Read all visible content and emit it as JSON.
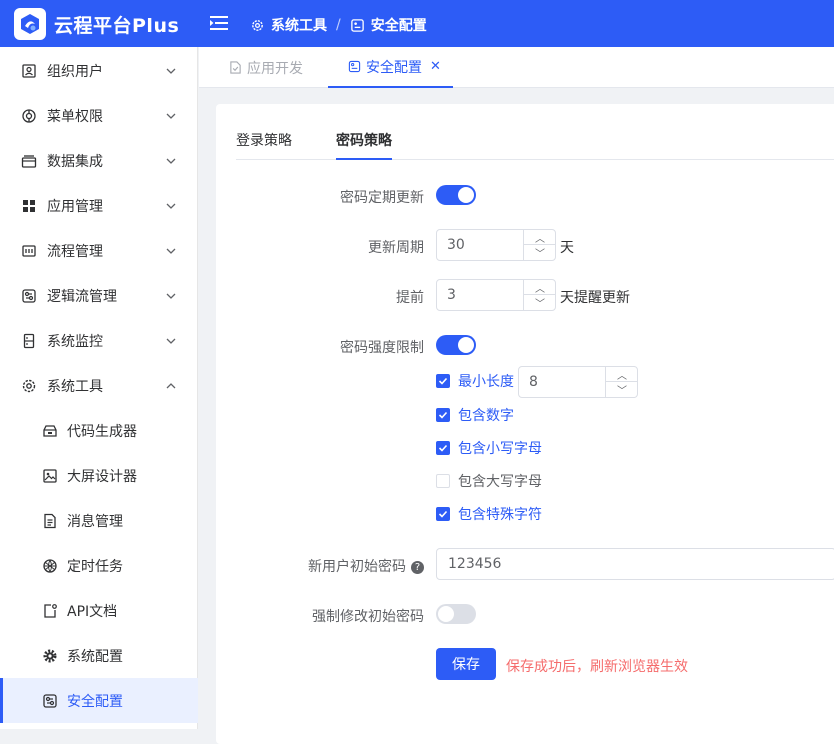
{
  "app": {
    "title": "云程平台Plus"
  },
  "breadcrumb": {
    "parent": "系统工具",
    "sep": "/",
    "current": "安全配置"
  },
  "sidebar": {
    "items": [
      {
        "label": "组织用户",
        "icon": "org-user-icon"
      },
      {
        "label": "菜单权限",
        "icon": "menu-perm-icon"
      },
      {
        "label": "数据集成",
        "icon": "data-integration-icon"
      },
      {
        "label": "应用管理",
        "icon": "app-grid-icon"
      },
      {
        "label": "流程管理",
        "icon": "flow-icon"
      },
      {
        "label": "逻辑流管理",
        "icon": "logic-flow-icon"
      },
      {
        "label": "系统监控",
        "icon": "monitor-icon"
      },
      {
        "label": "系统工具",
        "icon": "gear-icon"
      }
    ],
    "subitems": [
      {
        "label": "代码生成器",
        "icon": "code-gen-icon"
      },
      {
        "label": "大屏设计器",
        "icon": "image-icon"
      },
      {
        "label": "消息管理",
        "icon": "document-icon"
      },
      {
        "label": "定时任务",
        "icon": "timer-icon"
      },
      {
        "label": "API文档",
        "icon": "api-doc-icon"
      },
      {
        "label": "系统配置",
        "icon": "settings-icon"
      },
      {
        "label": "安全配置",
        "icon": "security-config-icon"
      }
    ]
  },
  "tabs": [
    {
      "label": "应用开发",
      "active": false
    },
    {
      "label": "安全配置",
      "active": true,
      "close": "✕"
    }
  ],
  "inner_tabs": [
    {
      "label": "登录策略",
      "active": false
    },
    {
      "label": "密码策略",
      "active": true
    }
  ],
  "form": {
    "periodic_update": {
      "label": "密码定期更新",
      "on": true
    },
    "update_cycle": {
      "label": "更新周期",
      "value": "30",
      "unit": "天"
    },
    "advance": {
      "label": "提前",
      "value": "3",
      "unit": "天提醒更新"
    },
    "strength": {
      "label": "密码强度限制",
      "on": true
    },
    "min_length": {
      "label": "最小长度",
      "value": "8",
      "checked": true
    },
    "checks": [
      {
        "label": "包含数字",
        "checked": true
      },
      {
        "label": "包含小写字母",
        "checked": true
      },
      {
        "label": "包含大写字母",
        "checked": false
      },
      {
        "label": "包含特殊字符",
        "checked": true
      }
    ],
    "init_password": {
      "label": "新用户初始密码",
      "help": "?",
      "value": "123456"
    },
    "force_change": {
      "label": "强制修改初始密码",
      "on": false
    },
    "save_label": "保存",
    "save_tip": "保存成功后，刷新浏览器生效"
  },
  "colors": {
    "primary": "#2d5cf6",
    "danger": "#f56c6c"
  }
}
